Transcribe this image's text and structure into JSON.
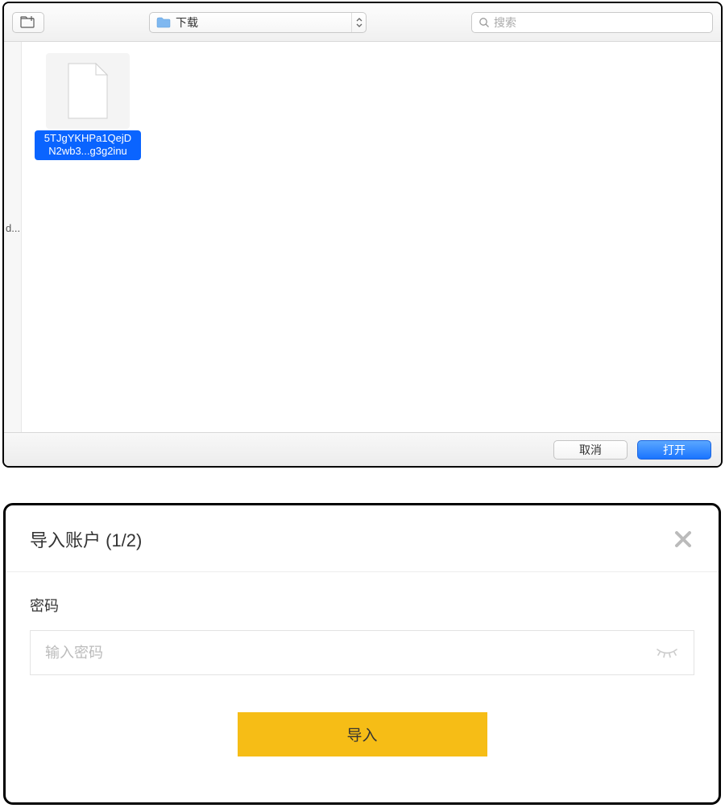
{
  "fileDialog": {
    "location": "下载",
    "searchPlaceholder": "搜索",
    "sidebarTruncated": "d...",
    "file": {
      "nameLine1": "5TJgYKHPa1QejD",
      "nameLine2": "N2wb3...g3g2inu"
    },
    "cancelLabel": "取消",
    "openLabel": "打开"
  },
  "importModal": {
    "title": "导入账户 (1/2)",
    "passwordLabel": "密码",
    "passwordPlaceholder": "输入密码",
    "importButton": "导入"
  }
}
